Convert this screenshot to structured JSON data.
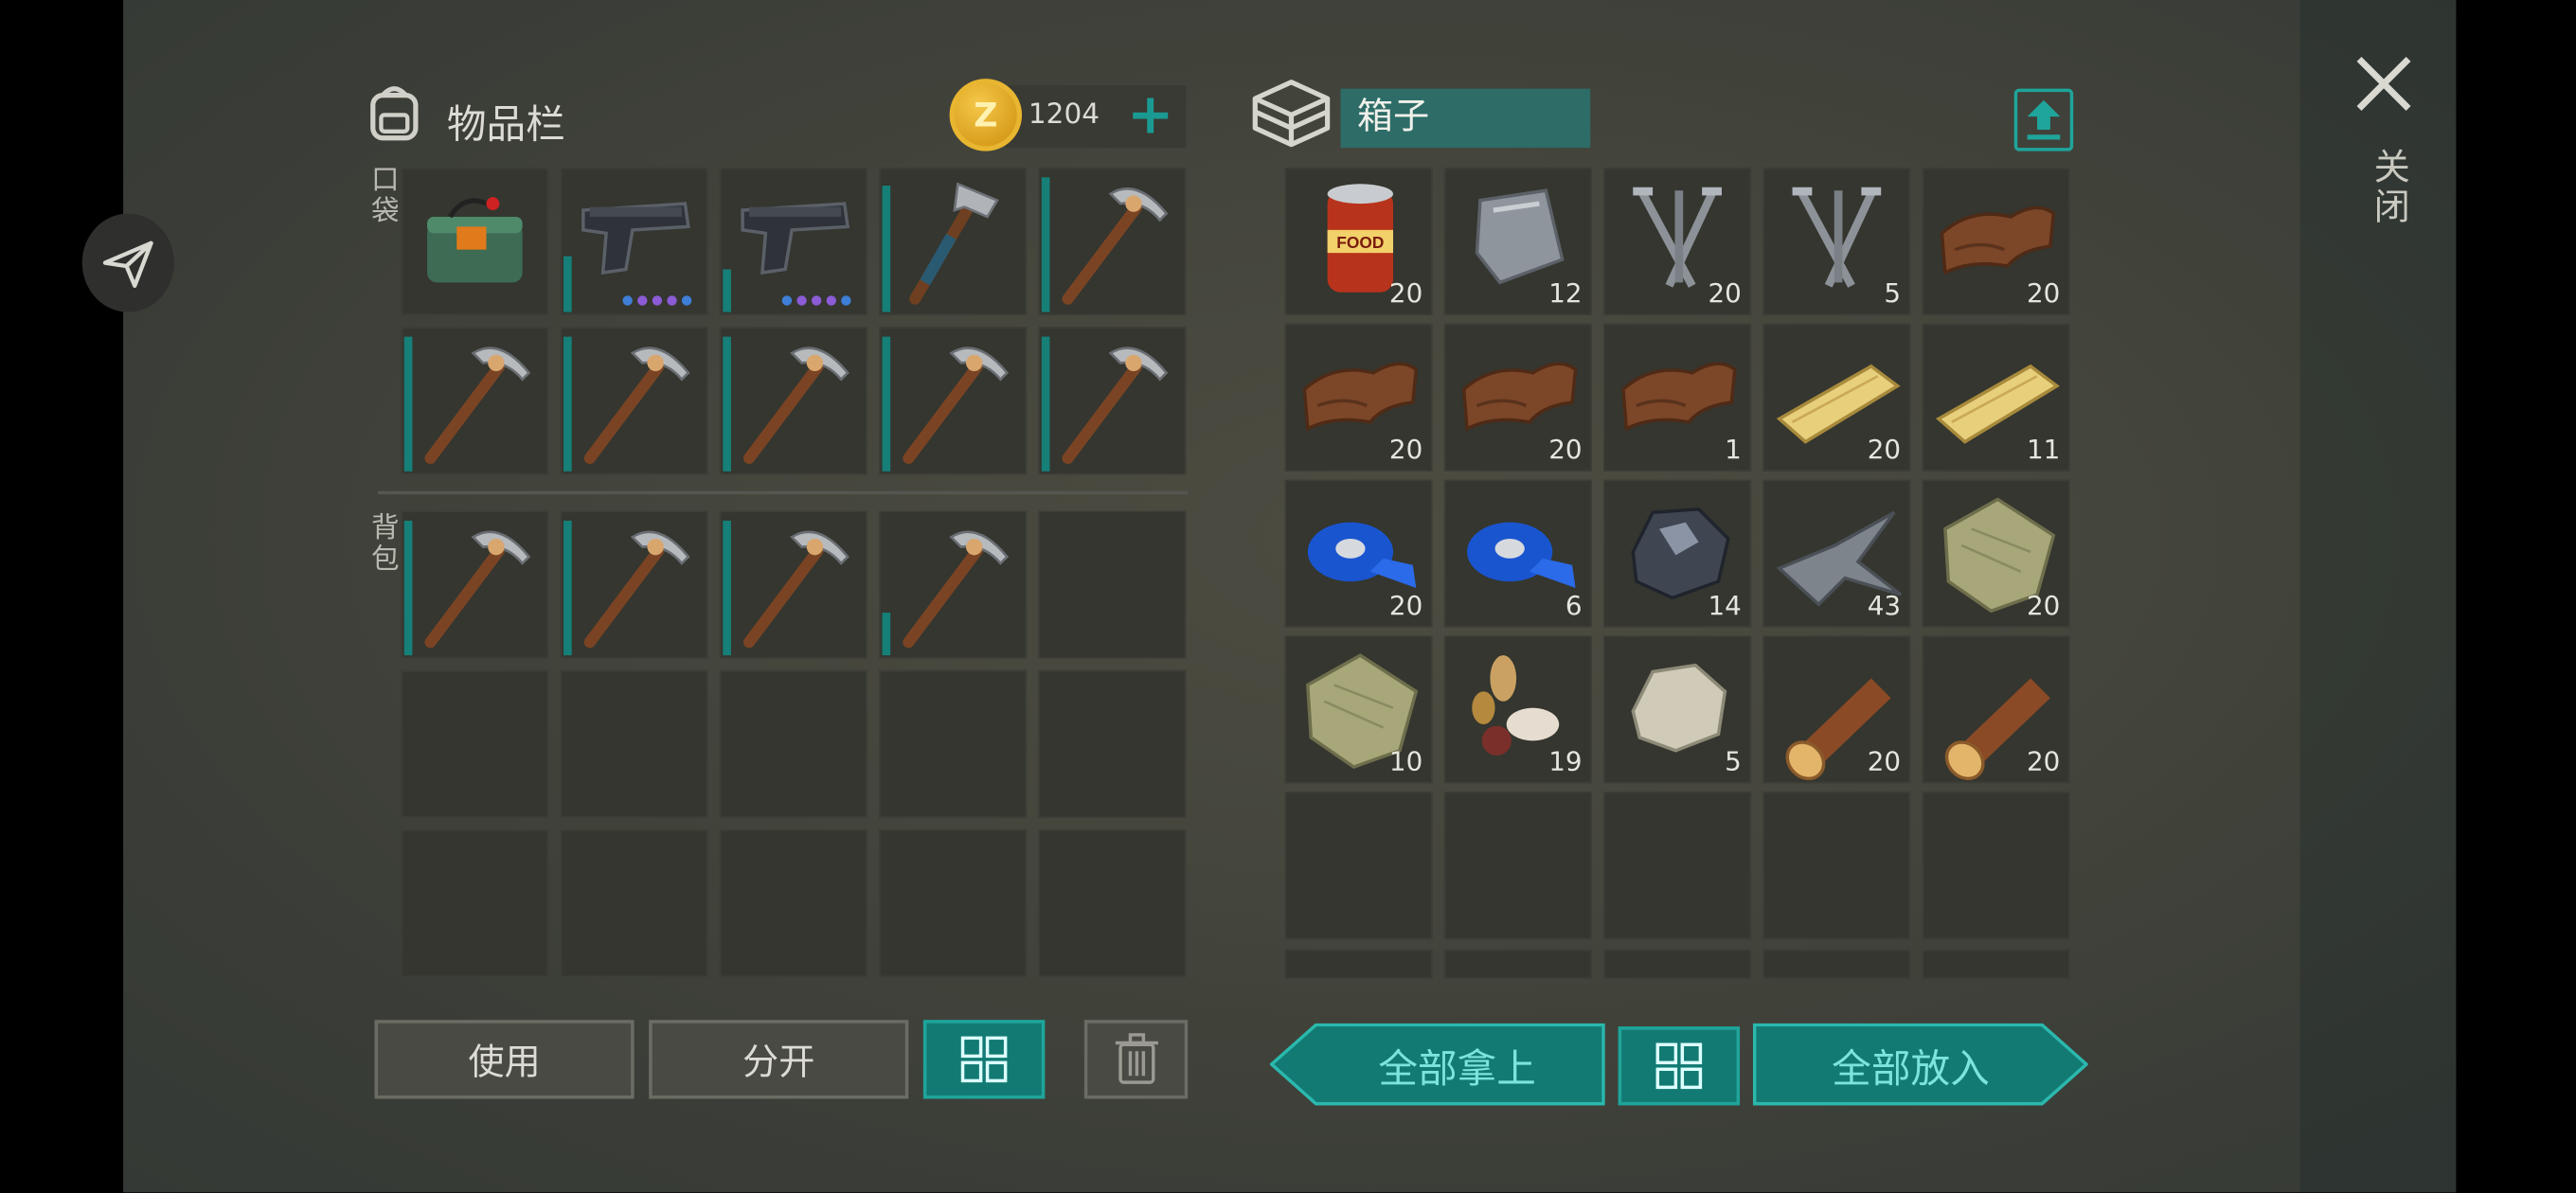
{
  "inventory": {
    "title": "物品栏",
    "coins": "1204",
    "add_label": "+",
    "pocket_label": "口袋",
    "backpack_label": "背包",
    "pocket": [
      {
        "icon": "c4-explosive-icon"
      },
      {
        "icon": "pistol-icon",
        "durability": 0.4,
        "mods": [
          "blue",
          "purple",
          "purple",
          "purple",
          "blue"
        ]
      },
      {
        "icon": "pistol-icon",
        "durability": 0.3,
        "mods": [
          "blue",
          "purple",
          "purple",
          "purple",
          "blue"
        ]
      },
      {
        "icon": "hatchet-icon",
        "durability": 0.9
      },
      {
        "icon": "pickaxe-icon",
        "durability": 0.95
      },
      {
        "icon": "pickaxe-icon",
        "durability": 0.95
      },
      {
        "icon": "pickaxe-icon",
        "durability": 0.95
      },
      {
        "icon": "pickaxe-icon",
        "durability": 0.95
      },
      {
        "icon": "pickaxe-icon",
        "durability": 0.95
      },
      {
        "icon": "pickaxe-icon",
        "durability": 0.95
      }
    ],
    "backpack": [
      {
        "icon": "pickaxe-icon",
        "durability": 0.95
      },
      {
        "icon": "pickaxe-icon",
        "durability": 0.95
      },
      {
        "icon": "pickaxe-icon",
        "durability": 0.95
      },
      {
        "icon": "pickaxe-icon",
        "durability": 0.3
      },
      null,
      null,
      null,
      null,
      null,
      null,
      null,
      null,
      null,
      null,
      null
    ],
    "buttons": {
      "use": "使用",
      "split": "分开"
    }
  },
  "chest": {
    "title": "箱子",
    "items": [
      {
        "icon": "canned-food-icon",
        "count": "20"
      },
      {
        "icon": "metal-plate-icon",
        "count": "12"
      },
      {
        "icon": "nails-icon",
        "count": "20"
      },
      {
        "icon": "nails-icon",
        "count": "5"
      },
      {
        "icon": "leather-icon",
        "count": "20"
      },
      {
        "icon": "leather-icon",
        "count": "20"
      },
      {
        "icon": "leather-icon",
        "count": "20"
      },
      {
        "icon": "leather-icon",
        "count": "1"
      },
      {
        "icon": "plank-icon",
        "count": "20"
      },
      {
        "icon": "plank-icon",
        "count": "11"
      },
      {
        "icon": "tape-icon",
        "count": "20"
      },
      {
        "icon": "tape-icon",
        "count": "6"
      },
      {
        "icon": "iron-ore-icon",
        "count": "14"
      },
      {
        "icon": "scrap-metal-icon",
        "count": "43"
      },
      {
        "icon": "cloth-icon",
        "count": "20"
      },
      {
        "icon": "cloth-icon",
        "count": "10"
      },
      {
        "icon": "seeds-icon",
        "count": "19"
      },
      {
        "icon": "stone-icon",
        "count": "5"
      },
      {
        "icon": "log-icon",
        "count": "20"
      },
      {
        "icon": "log-icon",
        "count": "20"
      },
      null,
      null,
      null,
      null,
      null
    ],
    "take_all": "全部拿上",
    "put_all": "全部放入"
  },
  "close_label": "关闭",
  "colors": {
    "accent": "#127a73",
    "accent_light": "#1fa59b",
    "text": "#dcdcd4"
  }
}
